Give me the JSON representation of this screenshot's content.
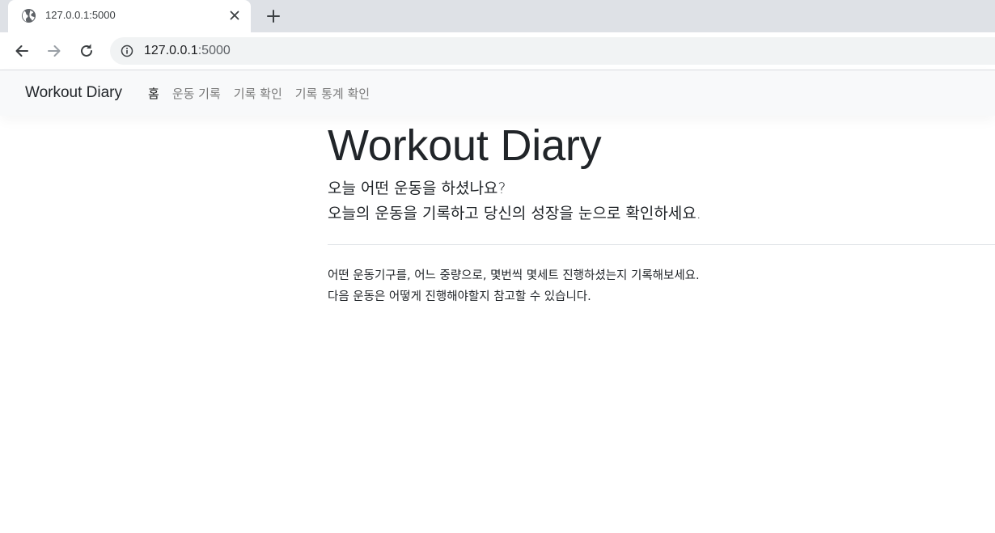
{
  "browser": {
    "tab": {
      "title": "127.0.0.1:5000"
    },
    "address_bar": {
      "host": "127.0.0.1",
      "port": ":5000"
    }
  },
  "navbar": {
    "brand": "Workout Diary",
    "links": [
      {
        "label": "홈",
        "active": true
      },
      {
        "label": "운동 기록",
        "active": false
      },
      {
        "label": "기록 확인",
        "active": false
      },
      {
        "label": "기록 통계 확인",
        "active": false
      }
    ]
  },
  "hero": {
    "title": "Workout Diary",
    "lead_lines": [
      "오늘 어떤 운동을 하셨나요?",
      "오늘의 운동을 기록하고 당신의 성장을 눈으로 확인하세요."
    ],
    "body_lines": [
      "어떤 운동기구를, 어느 중량으로, 몇번씩 몇세트 진행하셨는지 기록해보세요.",
      "다음 운동은 어떻게 진행해야할지 참고할 수 있습니다."
    ]
  },
  "icons": {
    "favicon": "globe-icon",
    "tab_close": "close-icon",
    "new_tab": "plus-icon",
    "back": "arrow-left-icon",
    "forward": "arrow-right-icon",
    "reload": "reload-icon",
    "site_info": "info-icon"
  },
  "colors": {
    "tabstrip": "#dee1e6",
    "navbar_bg": "#f8f9fa",
    "nav_link": "#7a7a7a",
    "nav_link_active": "#1a1a1a",
    "text": "#212529"
  }
}
